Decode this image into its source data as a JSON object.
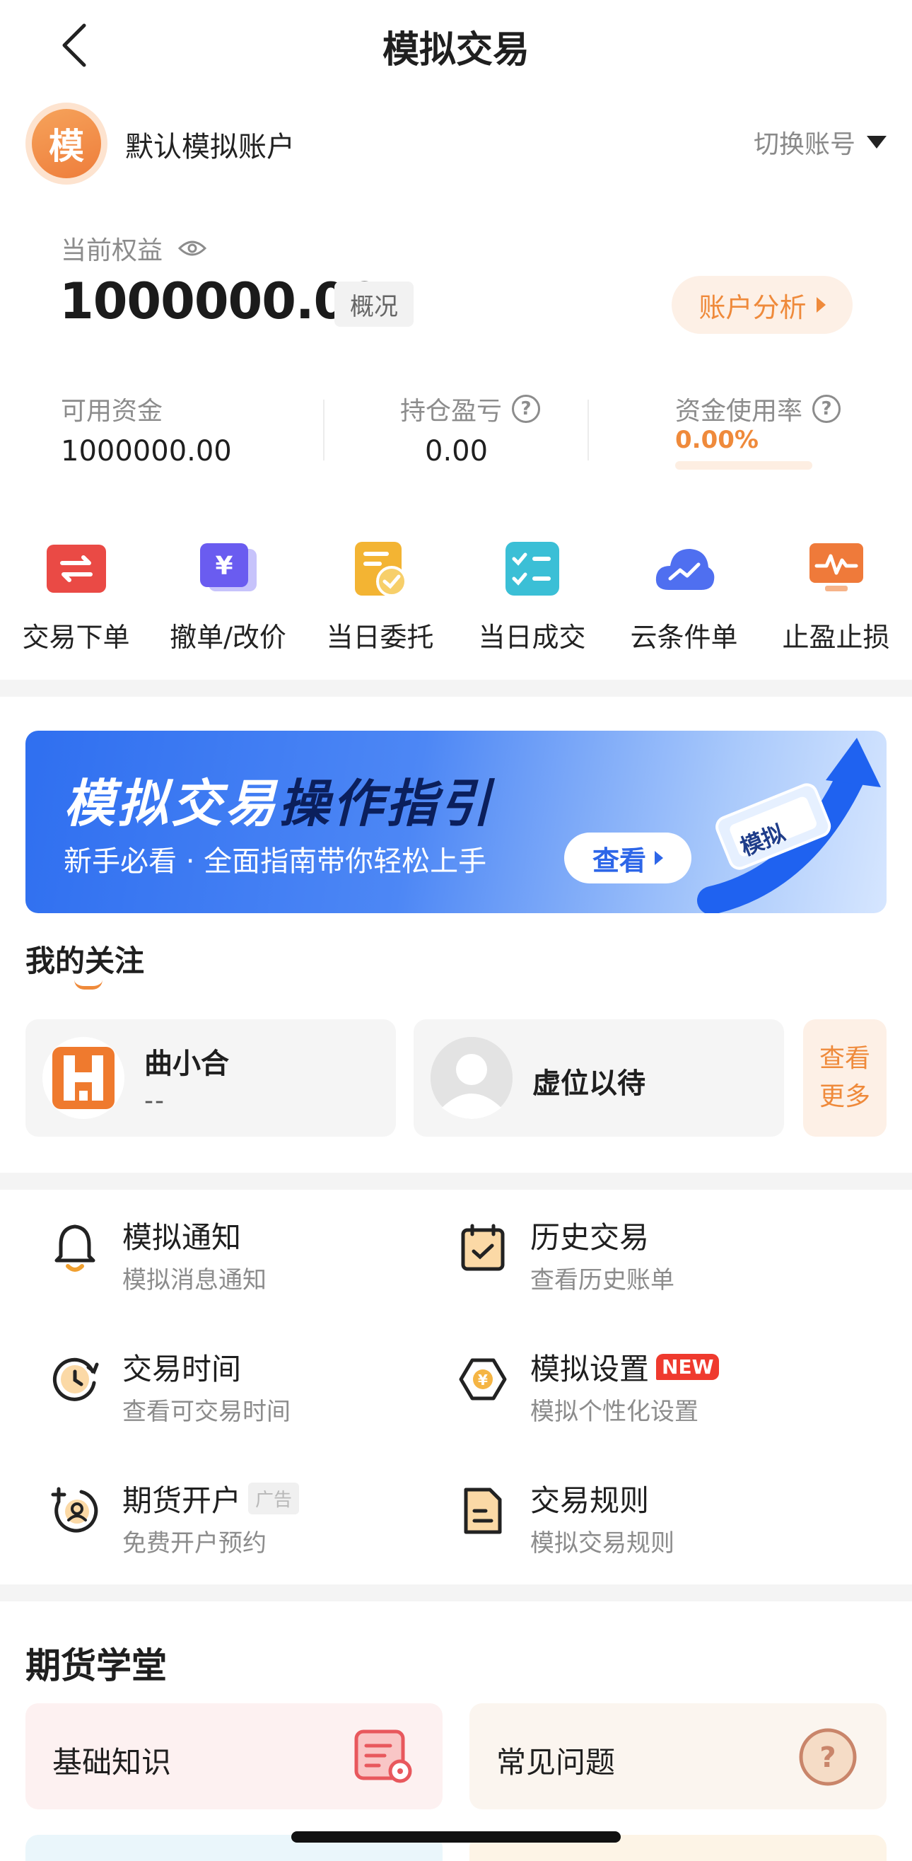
{
  "header": {
    "title": "模拟交易",
    "back_icon": "chevron-left-icon"
  },
  "account": {
    "avatar_char": "模",
    "name": "默认模拟账户",
    "switch_label": "切换账号"
  },
  "equity": {
    "label": "当前权益",
    "value": "1000000.00",
    "overview_label": "概况",
    "analysis_label": "账户分析"
  },
  "stats": {
    "available": {
      "label": "可用资金",
      "value": "1000000.00"
    },
    "position_pnl": {
      "label": "持仓盈亏",
      "value": "0.00"
    },
    "usage": {
      "label": "资金使用率",
      "value": "0.00%",
      "fraction": 0
    }
  },
  "quick_actions": [
    {
      "label": "交易下单",
      "icon": "trade-order-icon"
    },
    {
      "label": "撤单/改价",
      "icon": "cancel-modify-icon"
    },
    {
      "label": "当日委托",
      "icon": "daily-orders-icon"
    },
    {
      "label": "当日成交",
      "icon": "daily-trades-icon"
    },
    {
      "label": "云条件单",
      "icon": "cloud-condition-icon"
    },
    {
      "label": "止盈止损",
      "icon": "stop-profit-loss-icon"
    }
  ],
  "banner": {
    "title_part1": "模拟交易",
    "title_part2": "操作指引",
    "subtitle": "新手必看 · 全面指南带你轻松上手",
    "button_label": "查看",
    "badge_text": "模拟"
  },
  "following": {
    "title": "我的关注",
    "items": [
      {
        "name": "曲小合",
        "sub": "--"
      },
      {
        "name": "虚位以待",
        "sub": ""
      }
    ],
    "more_line1": "查看",
    "more_line2": "更多"
  },
  "menu": [
    {
      "title": "模拟通知",
      "sub": "模拟消息通知",
      "icon": "bell-icon",
      "badge": ""
    },
    {
      "title": "历史交易",
      "sub": "查看历史账单",
      "icon": "calendar-icon",
      "badge": ""
    },
    {
      "title": "交易时间",
      "sub": "查看可交易时间",
      "icon": "clock-icon",
      "badge": ""
    },
    {
      "title": "模拟设置",
      "sub": "模拟个性化设置",
      "icon": "settings-hex-icon",
      "badge": "NEW"
    },
    {
      "title": "期货开户",
      "sub": "免费开户预约",
      "icon": "add-user-icon",
      "badge": "广告"
    },
    {
      "title": "交易规则",
      "sub": "模拟交易规则",
      "icon": "document-icon",
      "badge": ""
    }
  ],
  "academy": {
    "title": "期货学堂",
    "cards": [
      {
        "label": "基础知识",
        "icon": "basic-knowledge-icon"
      },
      {
        "label": "常见问题",
        "icon": "question-icon"
      }
    ]
  }
}
